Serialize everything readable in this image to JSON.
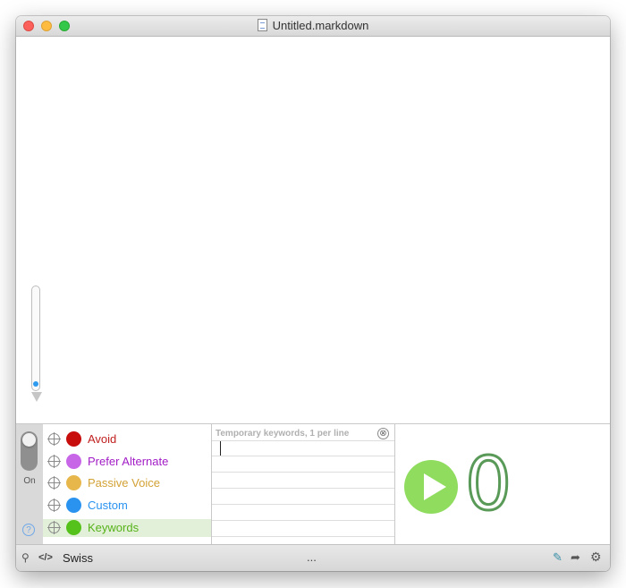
{
  "window": {
    "title": "Untitled.markdown"
  },
  "panel": {
    "toggle_label": "On",
    "help_label": "?",
    "categories": [
      {
        "label": "Avoid",
        "color": "#c80d0d",
        "text_color": "#c12020"
      },
      {
        "label": "Prefer Alternate",
        "color": "#c866e8",
        "text_color": "#a21dc6"
      },
      {
        "label": "Passive Voice",
        "color": "#e7b74c",
        "text_color": "#d3a235"
      },
      {
        "label": "Custom",
        "color": "#2a93f0",
        "text_color": "#2a93f0"
      },
      {
        "label": "Keywords",
        "color": "#55c21b",
        "text_color": "#55b219"
      }
    ],
    "keywords_placeholder": "Temporary keywords, 1 per line",
    "keywords_value": "",
    "clear_glyph": "⊗",
    "count": "0"
  },
  "bottombar": {
    "pin_glyph": "⚲",
    "code_glyph": "</>",
    "style_name": "Swiss",
    "more": "...",
    "highlight_glyph": "✎",
    "share_glyph": "➦",
    "gear_glyph": "⚙"
  },
  "colors": {
    "play": "#8fdc5f",
    "keyword_selected_bg": "#e3f0d9"
  }
}
